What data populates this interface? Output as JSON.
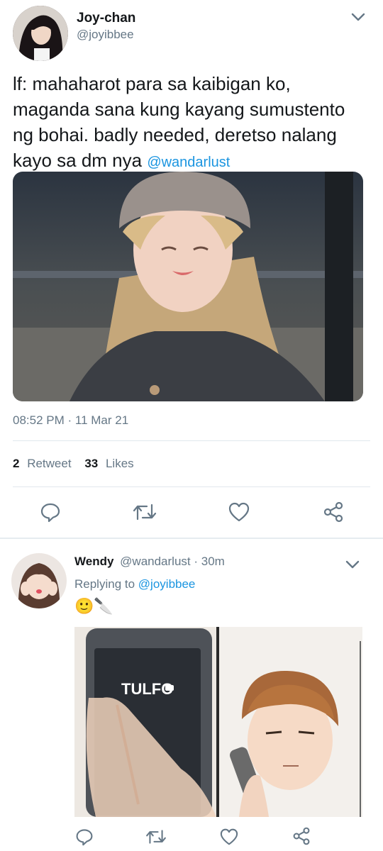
{
  "tweet": {
    "display_name": "Joy-chan",
    "handle": "@joyibbee",
    "text": "lf: mahaharot para sa kaibigan ko, maganda sana kung kayang sumustento ng bohai. badly needed, deretso nalang kayo sa dm nya ",
    "mention": "@wandarlust",
    "timestamp": "08:52 PM · 11 Mar 21",
    "retweet_count": "2",
    "retweet_label": "Retweet",
    "like_count": "33",
    "like_label": "Likes"
  },
  "reply": {
    "display_name": "Wendy",
    "handle": "@wandarlust",
    "time": "· 30m",
    "replying_to_label": "Replying to",
    "replying_to_handle": "@joyibbee",
    "text": "🙂🔪",
    "comic_text": "TULFO"
  },
  "icons": {
    "menu": "chevron-down-icon",
    "reply": "speech-bubble-icon",
    "retweet": "retweet-icon",
    "like": "heart-icon",
    "share": "share-icon"
  },
  "colors": {
    "accent": "#1b95e0",
    "muted": "#657786",
    "divider": "#e1e8ed"
  }
}
